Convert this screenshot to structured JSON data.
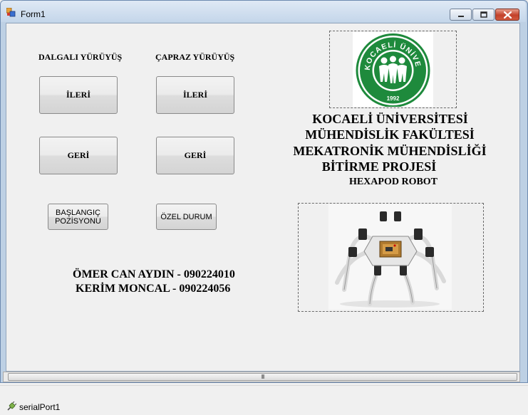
{
  "window": {
    "title": "Form1"
  },
  "colors": {
    "logo_green": "#1e8a3c",
    "close_red": "#c3412a"
  },
  "icons": {
    "app": "form-app-icon",
    "minimize": "minimize-icon",
    "maximize": "maximize-icon",
    "close": "close-icon",
    "serial": "serial-port-icon",
    "grip": "scroll-grip-icon"
  },
  "form": {
    "wave_gait_label": "DALGALI YÜRÜYÜŞ",
    "cross_gait_label": "ÇAPRAZ YÜRÜYÜŞ",
    "wave_forward": "İLERİ",
    "wave_back": "GERİ",
    "cross_forward": "İLERİ",
    "cross_back": "GERİ",
    "start_position_line1": "BAŞLANGIÇ",
    "start_position_line2": "POZİSYONU",
    "special_state": "ÖZEL DURUM",
    "heading_line1": "KOCAELİ ÜNİVERSİTESİ",
    "heading_line2": "MÜHENDİSLİK FAKÜLTESİ",
    "heading_line3": "MEKATRONİK MÜHENDİSLİĞİ",
    "heading_line4": "BİTİRME PROJESİ",
    "heading_line5": "HEXAPOD ROBOT",
    "author1": "ÖMER CAN AYDIN - 090224010",
    "author2": "KERİM MONCAL - 090224056"
  },
  "logo": {
    "ring_top": "KOCAELİ ÜNİVERSİTESİ",
    "year": "1992"
  },
  "tray": {
    "component": "serialPort1"
  }
}
